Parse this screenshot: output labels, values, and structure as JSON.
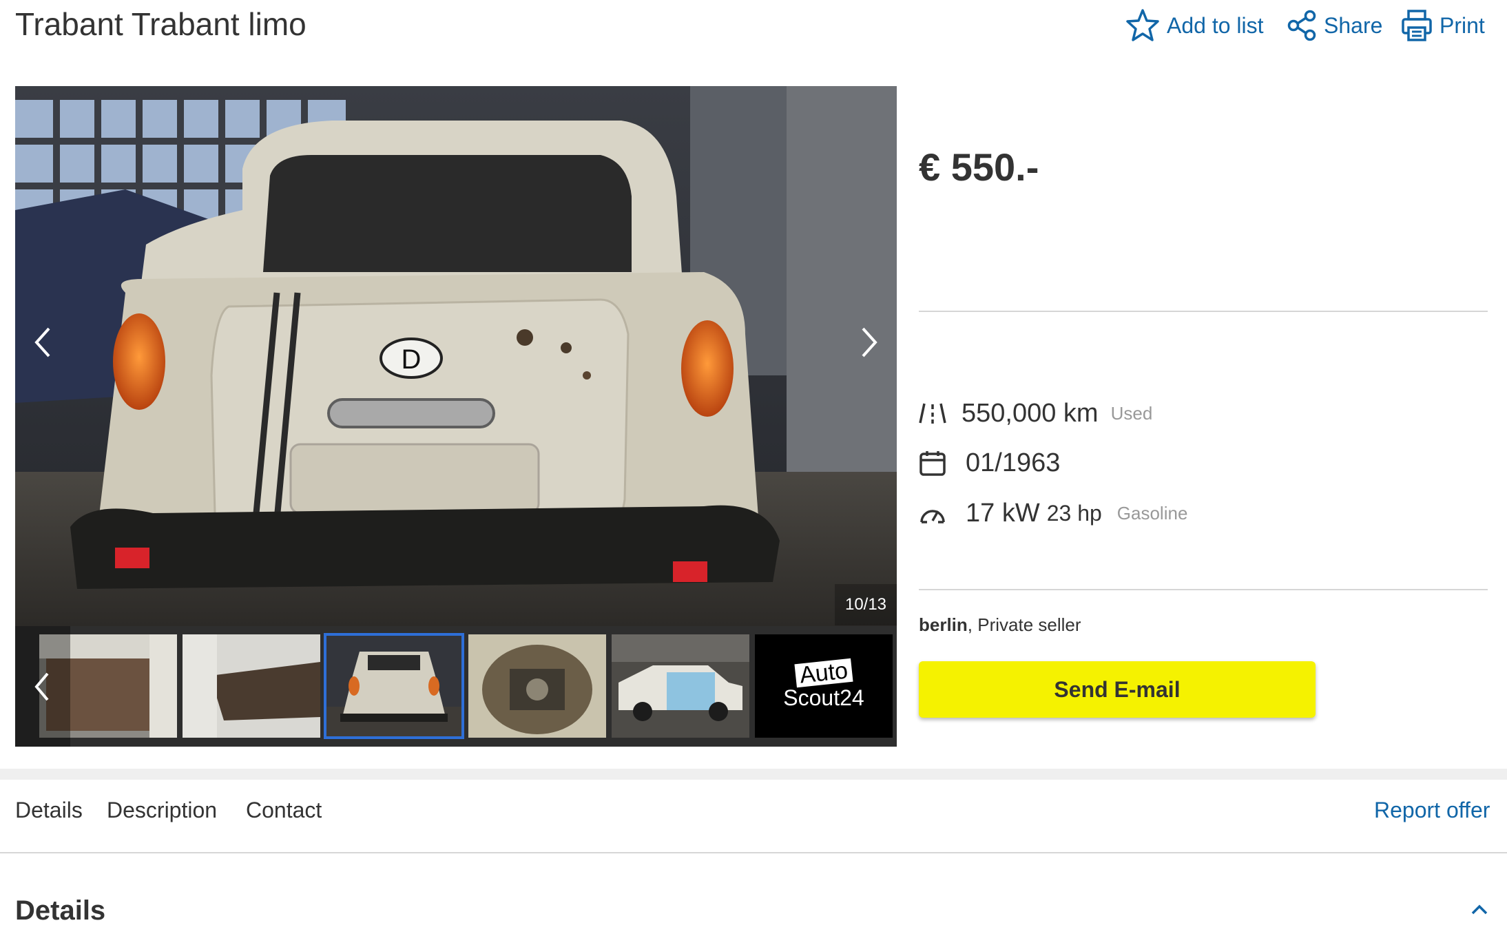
{
  "header": {
    "title": "Trabant Trabant limo",
    "actions": {
      "add_to_list": "Add to list",
      "share": "Share",
      "print": "Print"
    }
  },
  "gallery": {
    "counter": "10/13",
    "thumbnail_logo": {
      "line1": "Auto",
      "line2": "Scout24"
    }
  },
  "listing": {
    "price": "€ 550.-",
    "mileage": "550,000 km",
    "condition": "Used",
    "registration": "01/1963",
    "power_kw": "17 kW",
    "power_hp": "23 hp",
    "fuel": "Gasoline",
    "seller_city": "berlin",
    "seller_type": ", Private seller",
    "cta": "Send E-mail"
  },
  "tabs": {
    "details": "Details",
    "description": "Description",
    "contact": "Contact",
    "report": "Report offer"
  },
  "section": {
    "details_heading": "Details"
  },
  "colors": {
    "link_blue": "#1166a8",
    "cta_yellow": "#f5f200",
    "active_thumb_border": "#2e6fd8"
  }
}
